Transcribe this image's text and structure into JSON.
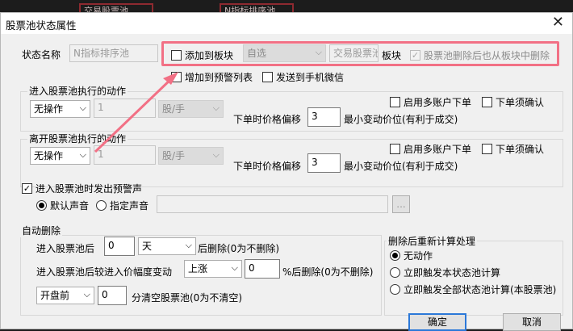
{
  "background": {
    "tab1": "交易股票池",
    "tab2": "N指标排序池"
  },
  "dialog": {
    "title": "股票池状态属性",
    "close_glyph": "✕",
    "state_name_label": "状态名称",
    "state_name_value": "N指标排序池",
    "add_to_block_label": "添加到板块",
    "add_to_block_checked": false,
    "block_select": "自选",
    "block_field": "交易股票池",
    "block_suffix": "板块",
    "remove_from_block_label": "股票池删除后也从板块中删除",
    "remove_from_block_checked": true,
    "add_to_warning_label": "增加到预警列表",
    "send_wechat_label": "发送到手机微信",
    "enter": {
      "title": "进入股票池执行的动作",
      "action": "无操作",
      "qty": "1",
      "unit": "股/手",
      "multi_account": "启用多账户下单",
      "confirm_order": "下单须确认",
      "price_offset_label": "下单时价格偏移",
      "price_offset_value": "3",
      "price_offset_unit": "最小变动价位(有利于成交)"
    },
    "leave": {
      "title": "离开股票池执行的动作",
      "action": "无操作",
      "qty": "1",
      "unit": "股/手",
      "multi_account": "启用多账户下单",
      "confirm_order": "下单须确认",
      "price_offset_label": "下单时价格偏移",
      "price_offset_value": "3",
      "price_offset_unit": "最小变动价位(有利于成交)"
    },
    "sound": {
      "enter_sound_label": "进入股票池时发出预警声",
      "enter_sound_checked": true,
      "default_sound": "默认声音",
      "custom_sound": "指定声音",
      "browse": "..."
    },
    "auto_delete": {
      "title": "自动删除",
      "row1_prefix": "进入股票池后",
      "row1_value": "0",
      "row1_unit": "天",
      "row1_suffix": "后删除(0为不删除)",
      "row2_prefix": "进入股票池后较进入价幅度变动",
      "row2_dir": "上涨",
      "row2_value": "0",
      "row2_suffix": "%后删除(0为不删除)",
      "row3_select": "开盘前",
      "row3_value": "0",
      "row3_suffix": "分清空股票池(0为不清空)"
    },
    "recalc": {
      "title": "删除后重新计算处理",
      "opt1": "无动作",
      "opt2": "立即触发本状态池计算",
      "opt3": "立即触发全部状态池计算(本股票池)"
    },
    "ok": "确定",
    "cancel": "取消"
  },
  "colors": {
    "highlight": "#f27085",
    "arrow": "#f27085",
    "default_button_border": "#2b78d8"
  }
}
